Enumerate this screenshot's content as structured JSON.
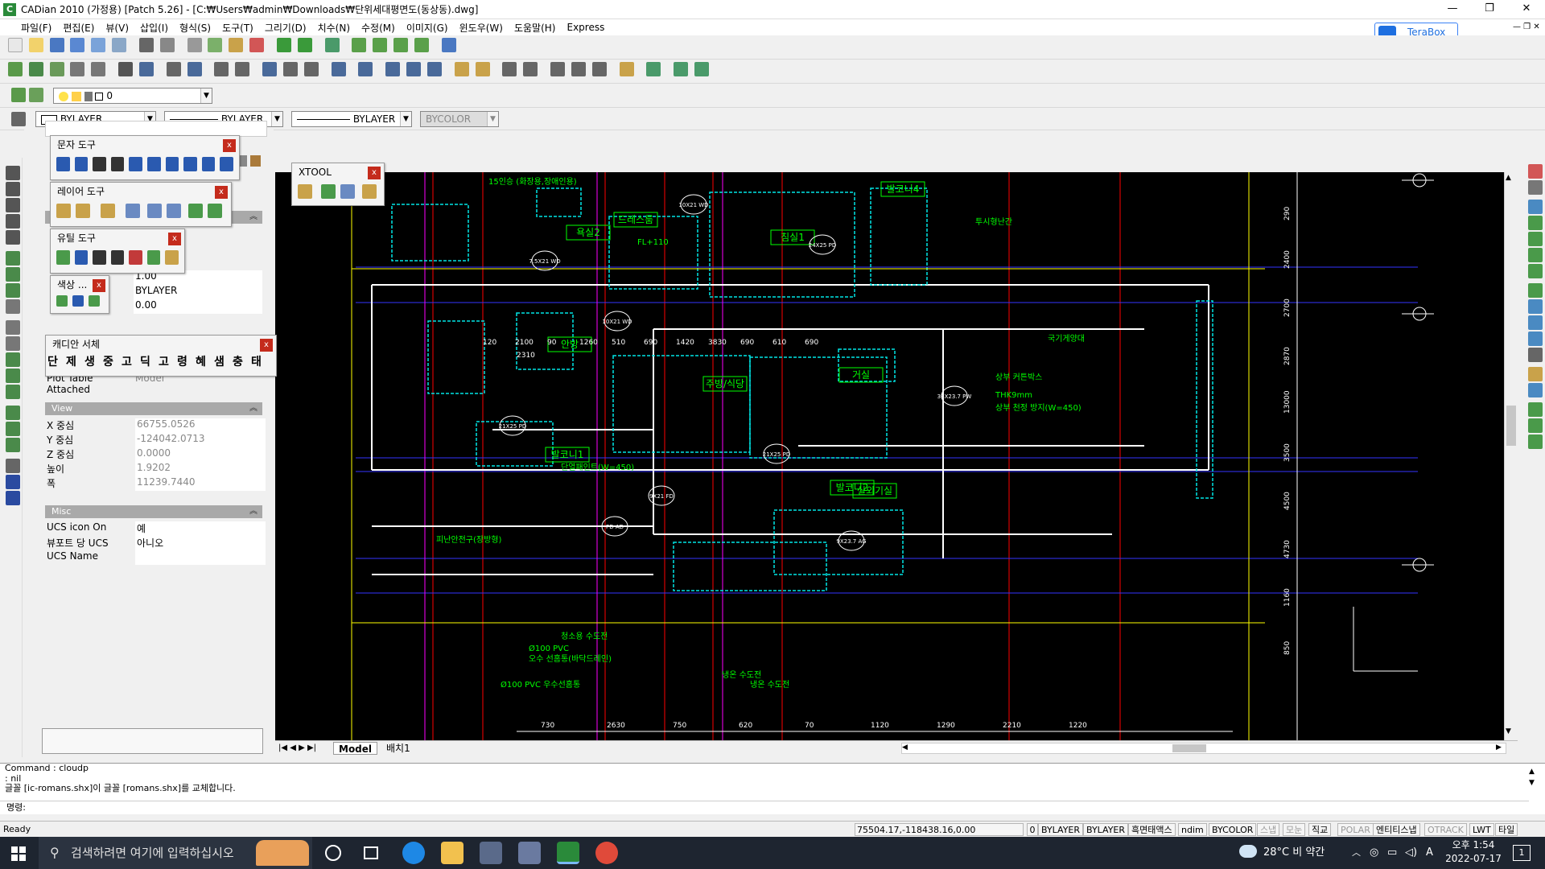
{
  "window": {
    "title": "CADian 2010 (가정용) [Patch 5.26] - [C:₩Users₩admin₩Downloads₩단위세대평면도(동상동).dwg]",
    "app_icon": "C"
  },
  "menu": [
    "파일(F)",
    "편집(E)",
    "뷰(V)",
    "삽입(I)",
    "형식(S)",
    "도구(T)",
    "그리기(D)",
    "치수(N)",
    "수정(M)",
    "이미지(G)",
    "윈도우(W)",
    "도움말(H)",
    "Express"
  ],
  "terabox_label": "TeraBox",
  "layer_combo": "0",
  "props_bar": {
    "color": "BYLAYER",
    "linetype": "BYLAYER",
    "lineweight": "BYLAYER",
    "plotstyle": "BYCOLOR"
  },
  "palettes": {
    "text_tools": "문자 도구",
    "layer_tools": "레이어 도구",
    "util_tools": "유틸 도구",
    "color": "색상 ...",
    "font_palette": "캐디안 서체",
    "font_samples": [
      "단",
      "제",
      "생",
      "중",
      "고",
      "딕",
      "고",
      "령",
      "혜",
      "샘",
      "충",
      "태"
    ],
    "xtool": "XTOOL",
    "close": "x"
  },
  "left_panel": {
    "general_values": [
      "1.00",
      "BYLAYER",
      "0.00"
    ],
    "plot_table_label": "Plot Table Attached",
    "plot_table_value": "Model",
    "view_section": "View",
    "view_rows": [
      {
        "k": "X 중심",
        "v": "66755.0526"
      },
      {
        "k": "Y 중심",
        "v": "-124042.0713"
      },
      {
        "k": "Z 중심",
        "v": "0.0000"
      },
      {
        "k": "높이",
        "v": "1.9202"
      },
      {
        "k": "폭",
        "v": "11239.7440"
      }
    ],
    "misc_section": "Misc",
    "misc_rows": [
      {
        "k": "UCS icon On",
        "v": "예"
      },
      {
        "k": "뷰포트 당 UCS",
        "v": "아니오"
      },
      {
        "k": "UCS Name",
        "v": ""
      }
    ]
  },
  "drawing": {
    "rooms": [
      "발코니4",
      "침실1",
      "드레스룸",
      "욕실2",
      "안방",
      "주방/식당",
      "거실",
      "발코니1",
      "발코니2",
      "실외기실"
    ],
    "labels": [
      "FL+110",
      "15인승 (화장용,장애인용)",
      "투시형난간",
      "국기게양대",
      "상부 커튼박스",
      "THK9mm",
      "상부 천정 방지(W=450)",
      "단열패인트(W=450)",
      "피난안전구(장방형)",
      "청소용 수도전",
      "Ø100 PVC",
      "오수 선홈통(바닥드레인)",
      "Ø100 PVC 우수선홈통",
      "냉온 수도전",
      "냉온 수도전"
    ],
    "dim_top": [
      "120",
      "2100",
      "90",
      "1260",
      "510",
      "690",
      "1420",
      "3830",
      "690",
      "610",
      "690"
    ],
    "dim_top_sub": "2310",
    "dim_bottom": [
      "730",
      "2630",
      "750",
      "620",
      "70",
      "1120",
      "1290",
      "2210",
      "1220"
    ],
    "dim_right": [
      "290",
      "2400",
      "2700",
      "2870",
      "13000",
      "3500",
      "4500",
      "4730",
      "1160",
      "850"
    ],
    "tags": [
      "10X21 WD",
      "24X25 PD",
      "7.5X21 WD",
      "10X21 WD",
      "21X25 PD",
      "21X25 PD",
      "38X23.7 PW",
      "9X21 FD",
      "9X23.7 AG",
      "PD AD"
    ]
  },
  "tabs": [
    "Model",
    "배치1"
  ],
  "command": {
    "lines": [
      "Command : cloudp",
      ": nil",
      "글꼴 [ic-romans.shx]이 글꼴 [romans.shx]를 교체합니다."
    ],
    "prompt": "명령:"
  },
  "status": {
    "ready": "Ready",
    "coords": "75504.17,-118438.16,0.00",
    "zero": "0",
    "toggles": [
      {
        "label": "BYLAYER",
        "on": true
      },
      {
        "label": "BYLAYER",
        "on": true
      },
      {
        "label": "흑면태액스",
        "on": true
      },
      {
        "label": "ndim",
        "on": true
      },
      {
        "label": "BYCOLOR",
        "on": true
      },
      {
        "label": "스냅",
        "on": false
      },
      {
        "label": "모눈",
        "on": false
      },
      {
        "label": "직교",
        "on": true
      },
      {
        "label": "POLAR",
        "on": false
      },
      {
        "label": "엔티티스냅",
        "on": true
      },
      {
        "label": "OTRACK",
        "on": false
      },
      {
        "label": "LWT",
        "on": true
      },
      {
        "label": "타일",
        "on": true
      }
    ]
  },
  "taskbar": {
    "search_placeholder": "검색하려면 여기에 입력하십시오",
    "weather": "28°C 비 약간",
    "ime": "A",
    "time": "오후 1:54",
    "date": "2022-07-17",
    "notif": "1"
  },
  "colors": {
    "canvas": "#000000",
    "cyan": "#00e5e5",
    "green": "#00ff00",
    "magenta": "#ff00ff",
    "yellow": "#ffff00",
    "red": "#ff0000",
    "blue": "#3333ff",
    "white": "#ffffff"
  }
}
